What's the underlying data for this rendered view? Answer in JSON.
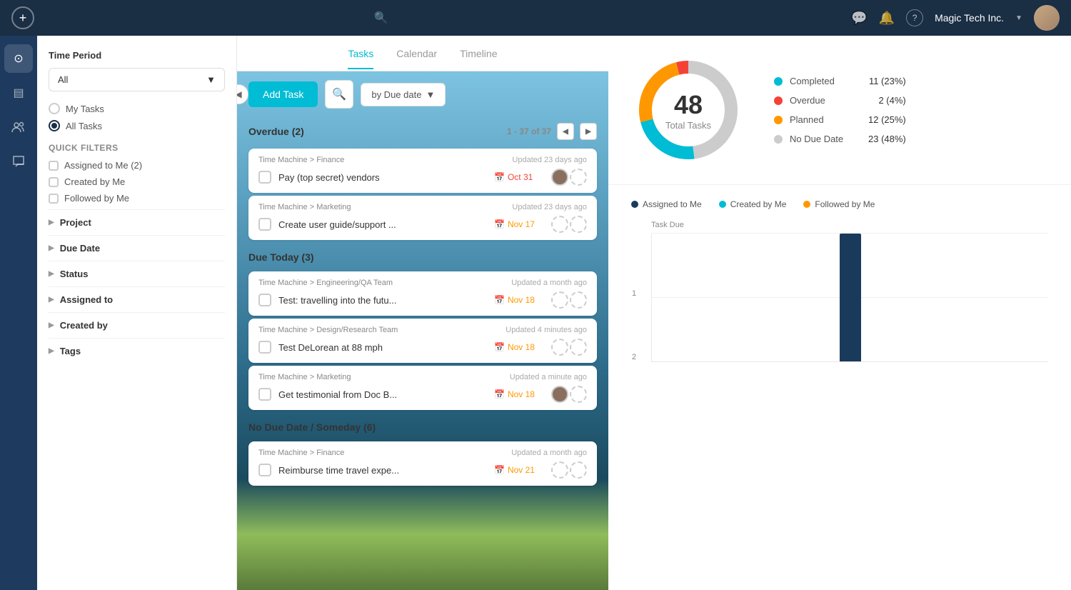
{
  "topNav": {
    "plusLabel": "+",
    "searchPlaceholder": "Search...",
    "companyName": "Magic Tech Inc.",
    "icons": {
      "chat": "💬",
      "bell": "🔔",
      "help": "?"
    }
  },
  "leftIcons": [
    {
      "name": "home-icon",
      "symbol": "⊙",
      "active": true
    },
    {
      "name": "folder-icon",
      "symbol": "▤",
      "active": false
    },
    {
      "name": "people-icon",
      "symbol": "👥",
      "active": false
    },
    {
      "name": "chat-icon",
      "symbol": "💬",
      "active": false
    }
  ],
  "filterSidebar": {
    "timePeriodLabel": "Time Period",
    "timePeriodValue": "All",
    "radioOptions": [
      {
        "label": "My Tasks",
        "selected": false
      },
      {
        "label": "All Tasks",
        "selected": true
      }
    ],
    "quickFiltersTitle": "Quick filters",
    "checkboxOptions": [
      {
        "label": "Assigned to Me (2)",
        "checked": false
      },
      {
        "label": "Created by Me",
        "checked": false
      },
      {
        "label": "Followed by Me",
        "checked": false
      }
    ],
    "collapsibles": [
      {
        "label": "Project"
      },
      {
        "label": "Due Date"
      },
      {
        "label": "Status"
      },
      {
        "label": "Assigned to"
      },
      {
        "label": "Created by"
      },
      {
        "label": "Tags"
      }
    ]
  },
  "tabs": [
    {
      "label": "Tasks",
      "active": true
    },
    {
      "label": "Calendar",
      "active": false
    },
    {
      "label": "Timeline",
      "active": false
    }
  ],
  "toolbar": {
    "addTaskLabel": "Add Task",
    "sortLabel": "by Due date"
  },
  "taskGroups": [
    {
      "title": "Overdue (2)",
      "count": "1 - 37 of 37",
      "tasks": [
        {
          "project": "Time Machine > Finance",
          "updated": "Updated 23 days ago",
          "title": "Pay (top secret) vendors",
          "due": "Oct 31",
          "dueClass": "overdue",
          "hasAvatar": true
        },
        {
          "project": "Time Machine > Marketing",
          "updated": "Updated 23 days ago",
          "title": "Create user guide/support ...",
          "due": "Nov 17",
          "dueClass": "upcoming",
          "hasAvatar": false
        }
      ]
    },
    {
      "title": "Due Today (3)",
      "count": "",
      "tasks": [
        {
          "project": "Time Machine > Engineering/QA Team",
          "updated": "Updated a month ago",
          "title": "Test: travelling into the futu...",
          "due": "Nov 18",
          "dueClass": "upcoming",
          "hasAvatar": false
        },
        {
          "project": "Time Machine > Design/Research Team",
          "updated": "Updated 4 minutes ago",
          "title": "Test DeLorean at 88 mph",
          "due": "Nov 18",
          "dueClass": "upcoming",
          "hasAvatar": false
        },
        {
          "project": "Time Machine > Marketing",
          "updated": "Updated a minute ago",
          "title": "Get testimonial from Doc B...",
          "due": "Nov 18",
          "dueClass": "upcoming",
          "hasAvatar": true
        }
      ]
    },
    {
      "title": "No Due Date / Someday (6)",
      "count": "",
      "tasks": [
        {
          "project": "Time Machine > Finance",
          "updated": "Updated a month ago",
          "title": "Reimburse time travel expe...",
          "due": "Nov 21",
          "dueClass": "upcoming",
          "hasAvatar": false
        }
      ]
    }
  ],
  "stats": {
    "totalTasks": 48,
    "totalLabel": "Total Tasks",
    "legend": [
      {
        "label": "Completed",
        "value": "11 (23%)",
        "color": "#00bcd4"
      },
      {
        "label": "Overdue",
        "value": "2 (4%)",
        "color": "#f44336"
      },
      {
        "label": "Planned",
        "value": "12 (25%)",
        "color": "#ff9800"
      },
      {
        "label": "No Due Date",
        "value": "23 (48%)",
        "color": "#cccccc"
      }
    ],
    "donut": {
      "completed": 23,
      "overdue": 4,
      "planned": 25,
      "noDueDate": 48
    }
  },
  "chart": {
    "taskDueLabel": "Task Due",
    "yValues": [
      "2",
      "1"
    ],
    "legend": [
      {
        "label": "Assigned to Me",
        "color": "#1a3a5c"
      },
      {
        "label": "Created by Me",
        "color": "#00bcd4"
      },
      {
        "label": "Followed by Me",
        "color": "#ff9800"
      }
    ]
  }
}
